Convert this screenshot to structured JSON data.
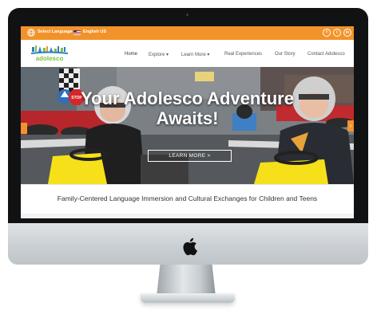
{
  "topbar": {
    "language_label": "Select Language",
    "language_value": "English US",
    "social": [
      {
        "icon": "facebook-icon",
        "glyph": "f"
      },
      {
        "icon": "twitter-icon",
        "glyph": "t"
      },
      {
        "icon": "linkedin-icon",
        "glyph": "in"
      }
    ]
  },
  "nav": {
    "logo_text": "adolesco",
    "items": [
      {
        "label": "Home"
      },
      {
        "label": "Explore ▾"
      },
      {
        "label": "Learn More ▾"
      },
      {
        "label": "Real Experiences"
      },
      {
        "label": "Our Story"
      },
      {
        "label": "Contact Adolesco"
      }
    ]
  },
  "hero": {
    "title_line1": "Your Adolesco Adventure",
    "title_line2": "Awaits!",
    "button_label": "LEARN MORE >",
    "sign_text": "STOP"
  },
  "tagline": "Family-Centered Language Immersion and Cultural Exchanges for Children and Teens",
  "colors": {
    "brand_orange": "#f2932a",
    "kart_yellow": "#f6e01a"
  }
}
